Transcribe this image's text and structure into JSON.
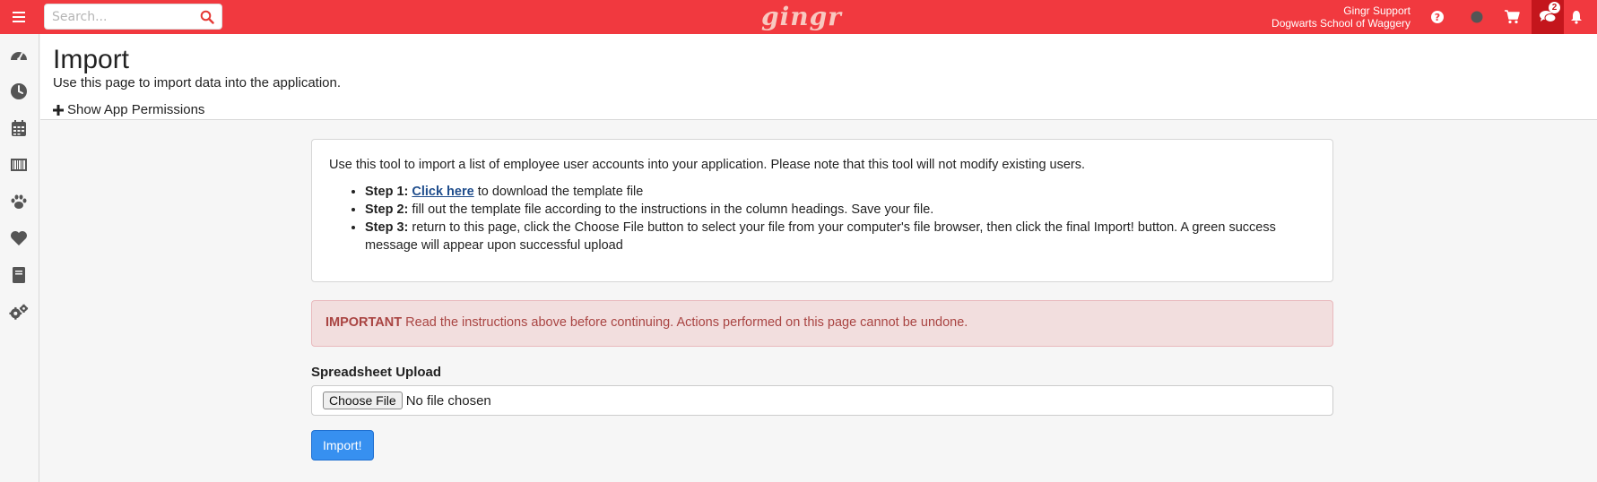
{
  "topbar": {
    "search_placeholder": "Search...",
    "logo": "gingr",
    "user_name": "Gingr Support",
    "location": "Dogwarts School of Waggery",
    "notifications_count": "2",
    "icons": [
      "hamburger-menu-icon",
      "search-icon",
      "help-icon",
      "status-dot-icon",
      "cart-icon",
      "chat-icon",
      "bell-icon"
    ],
    "colors": {
      "bar": "#f1393f",
      "active": "#c4161c"
    }
  },
  "sidebar": {
    "items": [
      {
        "icon": "dashboard-icon"
      },
      {
        "icon": "clock-icon"
      },
      {
        "icon": "calendar-icon"
      },
      {
        "icon": "barcode-icon"
      },
      {
        "icon": "paw-icon"
      },
      {
        "icon": "heart-icon"
      },
      {
        "icon": "book-icon"
      },
      {
        "icon": "settings-icon"
      }
    ]
  },
  "header": {
    "title": "Import",
    "subtitle": "Use this page to import data into the application.",
    "permissions_toggle": "Show App Permissions"
  },
  "instructions": {
    "intro": "Use this tool to import a list of employee user accounts into your application. Please note that this tool will not modify existing users.",
    "step1_label": "Step 1:",
    "step1_link": "Click here",
    "step1_text": " to download the template file",
    "step2_label": "Step 2:",
    "step2_text": " fill out the template file according to the instructions in the column headings. Save your file.",
    "step3_label": "Step 3:",
    "step3_text": " return to this page, click the Choose File button to select your file from your computer's file browser, then click the final Import! button. A green success message will appear upon successful upload"
  },
  "alert": {
    "label": "IMPORTANT",
    "text": " Read the instructions above before continuing. Actions performed on this page cannot be undone."
  },
  "upload": {
    "label": "Spreadsheet Upload",
    "choose_button": "Choose File",
    "status": "No file chosen",
    "submit": "Import!"
  }
}
